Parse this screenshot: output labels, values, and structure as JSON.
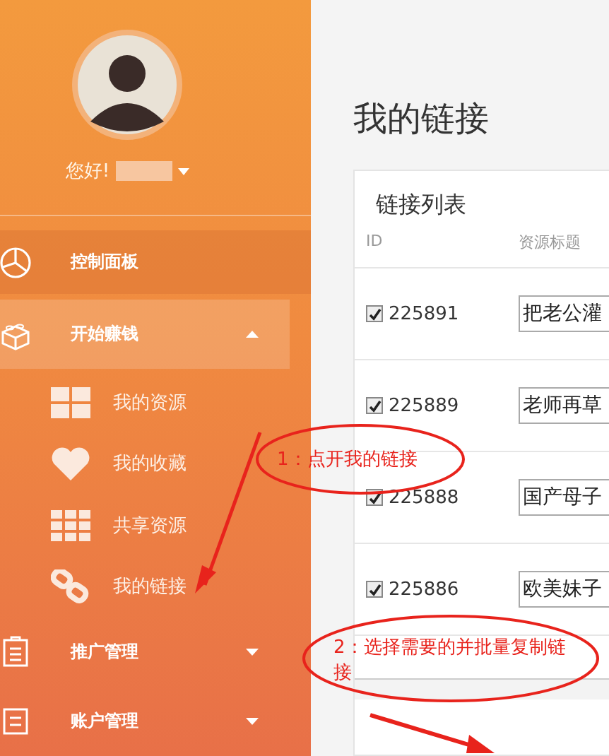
{
  "sidebar": {
    "greeting": "您好!",
    "menu": [
      {
        "label": "控制面板",
        "selected": false
      },
      {
        "label": "开始赚钱",
        "selected": true,
        "expanded": true,
        "children": [
          {
            "label": "我的资源"
          },
          {
            "label": "我的收藏"
          },
          {
            "label": "共享资源"
          },
          {
            "label": "我的链接"
          }
        ]
      },
      {
        "label": "推广管理",
        "selected": false,
        "expanded": false
      },
      {
        "label": "账户管理",
        "selected": false,
        "expanded": false
      }
    ]
  },
  "page_title": "我的链接",
  "card": {
    "title": "链接列表",
    "columns": [
      "ID",
      "资源标题"
    ],
    "rows": [
      {
        "checked": true,
        "id": "225891",
        "title": "把老公灌"
      },
      {
        "checked": true,
        "id": "225889",
        "title": "老师再草"
      },
      {
        "checked": true,
        "id": "225888",
        "title": "国产母子"
      },
      {
        "checked": true,
        "id": "225886",
        "title": "欧美妹子"
      }
    ]
  },
  "annotations": [
    "1：点开我的链接",
    "2：选择需要的并批量复制链接"
  ]
}
